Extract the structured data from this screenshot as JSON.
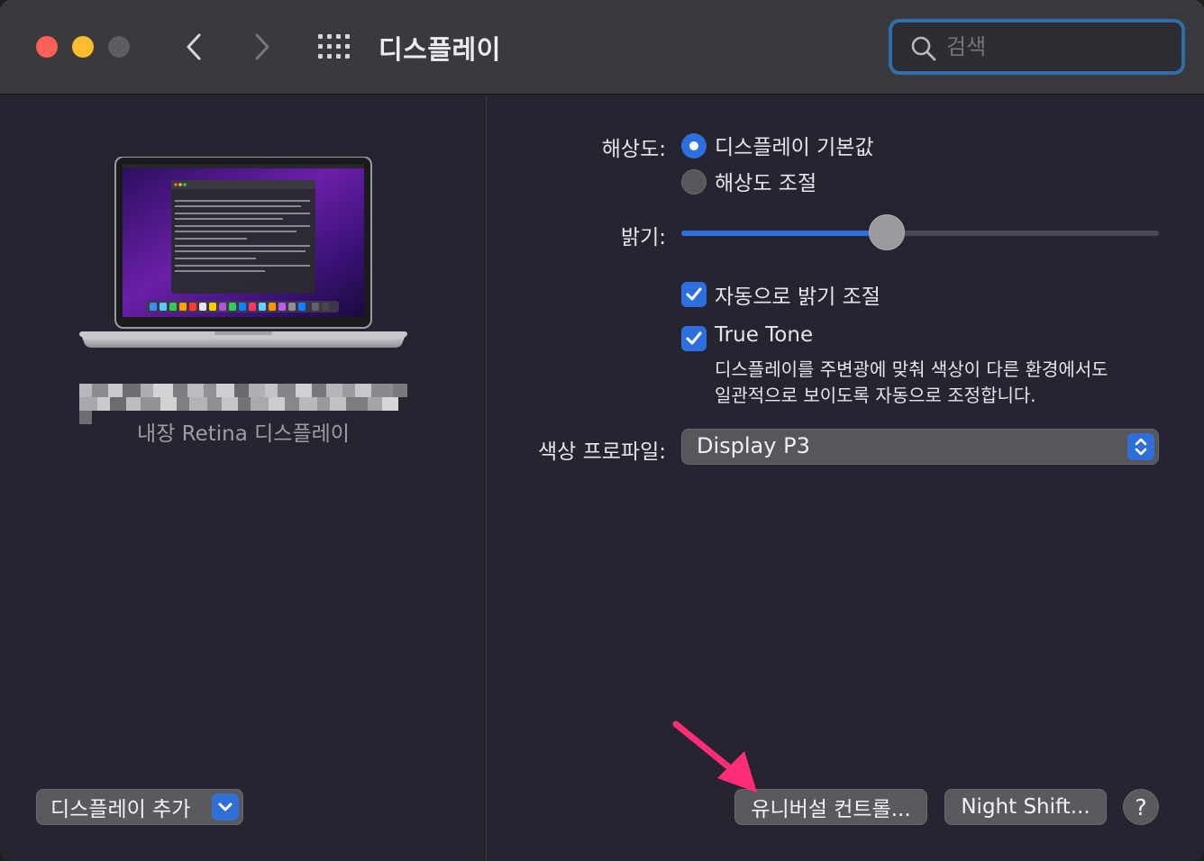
{
  "window": {
    "title": "디스플레이"
  },
  "search": {
    "placeholder": "검색"
  },
  "left": {
    "display_label": "내장 Retina 디스플레이",
    "add_display_label": "디스플레이 추가"
  },
  "right": {
    "resolution_label": "해상도:",
    "resolution_options": [
      "디스플레이 기본값",
      "해상도 조절"
    ],
    "resolution_selected": 0,
    "brightness_label": "밝기:",
    "brightness_value": 0.43,
    "auto_brightness_label": "자동으로 밝기 조절",
    "auto_brightness_checked": true,
    "true_tone_label": "True Tone",
    "true_tone_checked": true,
    "true_tone_desc_line1": "디스플레이를 주변광에 맞춰 색상이 다른 환경에서도",
    "true_tone_desc_line2": "일관적으로 보이도록 자동으로 조정합니다.",
    "color_profile_label": "색상 프로파일:",
    "color_profile_value": "Display P3"
  },
  "buttons": {
    "universal_control": "유니버설 컨트롤...",
    "night_shift": "Night Shift...",
    "help": "?"
  },
  "colors": {
    "accent": "#2e6fe0",
    "annotation_arrow": "#ff2d78"
  }
}
